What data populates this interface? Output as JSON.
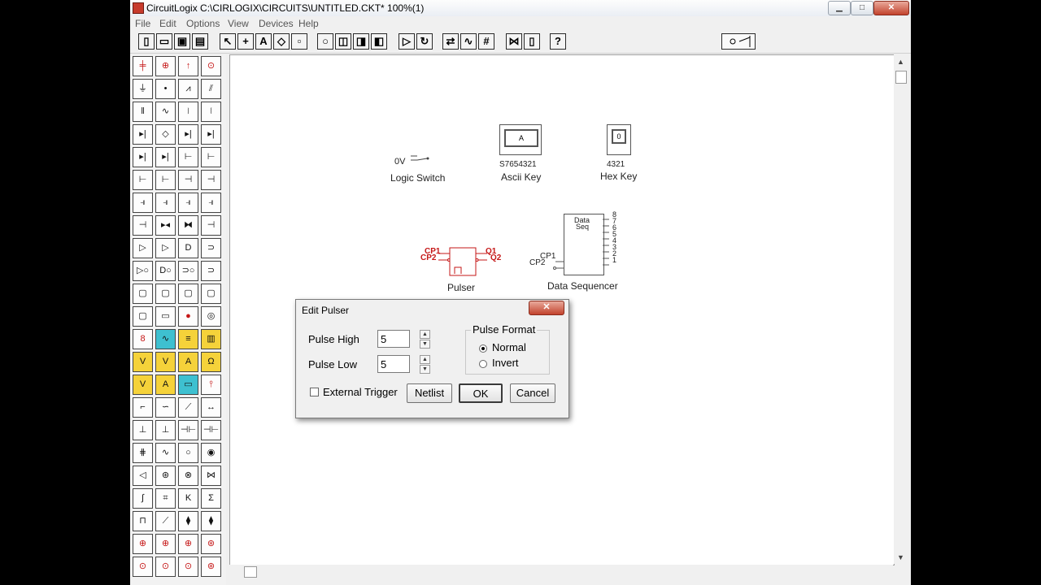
{
  "window": {
    "title": "CircuitLogix    C:\\CIRLOGIX\\CIRCUITS\\UNTITLED.CKT* 100%(1)",
    "minimize_glyph": "▁",
    "maximize_glyph": "□",
    "close_glyph": "✕"
  },
  "menu": [
    "File",
    "Edit",
    "Options",
    "View",
    "Devices",
    "Help"
  ],
  "toolbar": {
    "buttons": [
      "new-file-icon",
      "open-folder-icon",
      "save-icon",
      "print-icon",
      "select-pointer-icon",
      "wire-cross-icon",
      "text-tool-icon",
      "eraser-icon",
      "component-icon",
      "zoom-icon",
      "zoom-in-icon",
      "zoom-out-icon",
      "zoom-fit-icon",
      "run-simulation-icon",
      "refresh-icon",
      "probe-icon",
      "trace-icon",
      "grid-icon",
      "parts-icon",
      "bookmark-icon",
      "help-icon",
      "switch-icon"
    ],
    "text_glyph": "A",
    "help_glyph": "?"
  },
  "canvas": {
    "logic_switch": {
      "value": "0V",
      "label": "Logic Switch"
    },
    "ascii_key": {
      "display": "A",
      "pins": "S7654321",
      "label": "Ascii Key"
    },
    "hex_key": {
      "display": "0",
      "pins": "4321",
      "label": "Hex Key"
    },
    "pulser": {
      "cp1": "CP1",
      "cp2": "CP2",
      "q1": "Q1",
      "q2": "Q2",
      "label": "Pulser"
    },
    "data_sequencer": {
      "title_line1": "Data",
      "title_line2": "Seq",
      "cp1": "CP1",
      "cp2": "CP2",
      "outputs": [
        "8",
        "7",
        "6",
        "5",
        "4",
        "3",
        "2",
        "1"
      ],
      "label": "Data Sequencer"
    }
  },
  "dialog": {
    "title": "Edit Pulser",
    "close_glyph": "✕",
    "pulse_high_label": "Pulse High",
    "pulse_high_value": "5",
    "pulse_low_label": "Pulse Low",
    "pulse_low_value": "5",
    "format_group_label": "Pulse Format",
    "format_options": [
      "Normal",
      "Invert"
    ],
    "format_selected": "Normal",
    "external_trigger_label": "External Trigger",
    "external_trigger_checked": false,
    "netlist_label": "Netlist",
    "ok_label": "OK",
    "cancel_label": "Cancel"
  },
  "colors": {
    "accent_red": "#c51717"
  }
}
